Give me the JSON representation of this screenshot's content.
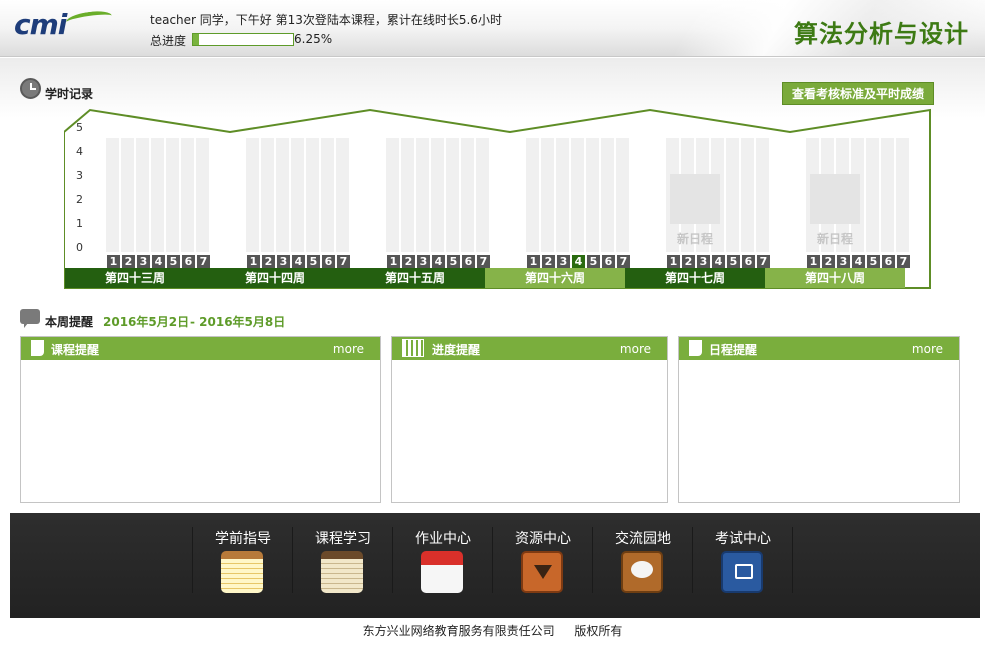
{
  "header": {
    "logo_text": "cmi",
    "user_line": "teacher 同学，下午好  第13次登陆本课程，累计在线时长5.6小时",
    "progress_label": "总进度",
    "progress_value": 6.25,
    "progress_text": "6.25%",
    "course_title": "算法分析与设计"
  },
  "study": {
    "title": "学时记录",
    "check_button": "查看考核标准及平时成绩",
    "y_ticks": [
      "5",
      "4",
      "3",
      "2",
      "1",
      "0"
    ],
    "days": [
      "1",
      "2",
      "3",
      "4",
      "5",
      "6",
      "7"
    ],
    "weeks": [
      {
        "label": "第四十三周",
        "style": "dark",
        "new_schedule": ""
      },
      {
        "label": "第四十四周",
        "style": "dark",
        "new_schedule": ""
      },
      {
        "label": "第四十五周",
        "style": "dark",
        "new_schedule": ""
      },
      {
        "label": "第四十六周",
        "style": "light",
        "new_schedule": "",
        "highlight_day": 4
      },
      {
        "label": "第四十七周",
        "style": "dark",
        "new_schedule": "新日程"
      },
      {
        "label": "第四十八周",
        "style": "light",
        "new_schedule": "新日程"
      }
    ]
  },
  "reminders": {
    "title": "本周提醒",
    "date_start": "2016年5月2日",
    "date_end": "- 2016年5月8日",
    "panels": [
      {
        "title": "课程提醒",
        "more": "more"
      },
      {
        "title": "进度提醒",
        "more": "more"
      },
      {
        "title": "日程提醒",
        "more": "more"
      }
    ]
  },
  "nav": {
    "items": [
      {
        "label": "学前指导",
        "icon": "notepad-yellow-icon"
      },
      {
        "label": "课程学习",
        "icon": "notepad-brown-icon"
      },
      {
        "label": "作业中心",
        "icon": "calendar-icon"
      },
      {
        "label": "资源中心",
        "icon": "download-icon"
      },
      {
        "label": "交流园地",
        "icon": "chat-icon"
      },
      {
        "label": "考试中心",
        "icon": "book-icon"
      }
    ]
  },
  "footer": {
    "company": "东方兴业网络教育服务有限责任公司",
    "rights": "版权所有"
  },
  "colors": {
    "accent_green": "#7aae3d",
    "dark_green": "#245f10",
    "title_green": "#3d7a14"
  }
}
